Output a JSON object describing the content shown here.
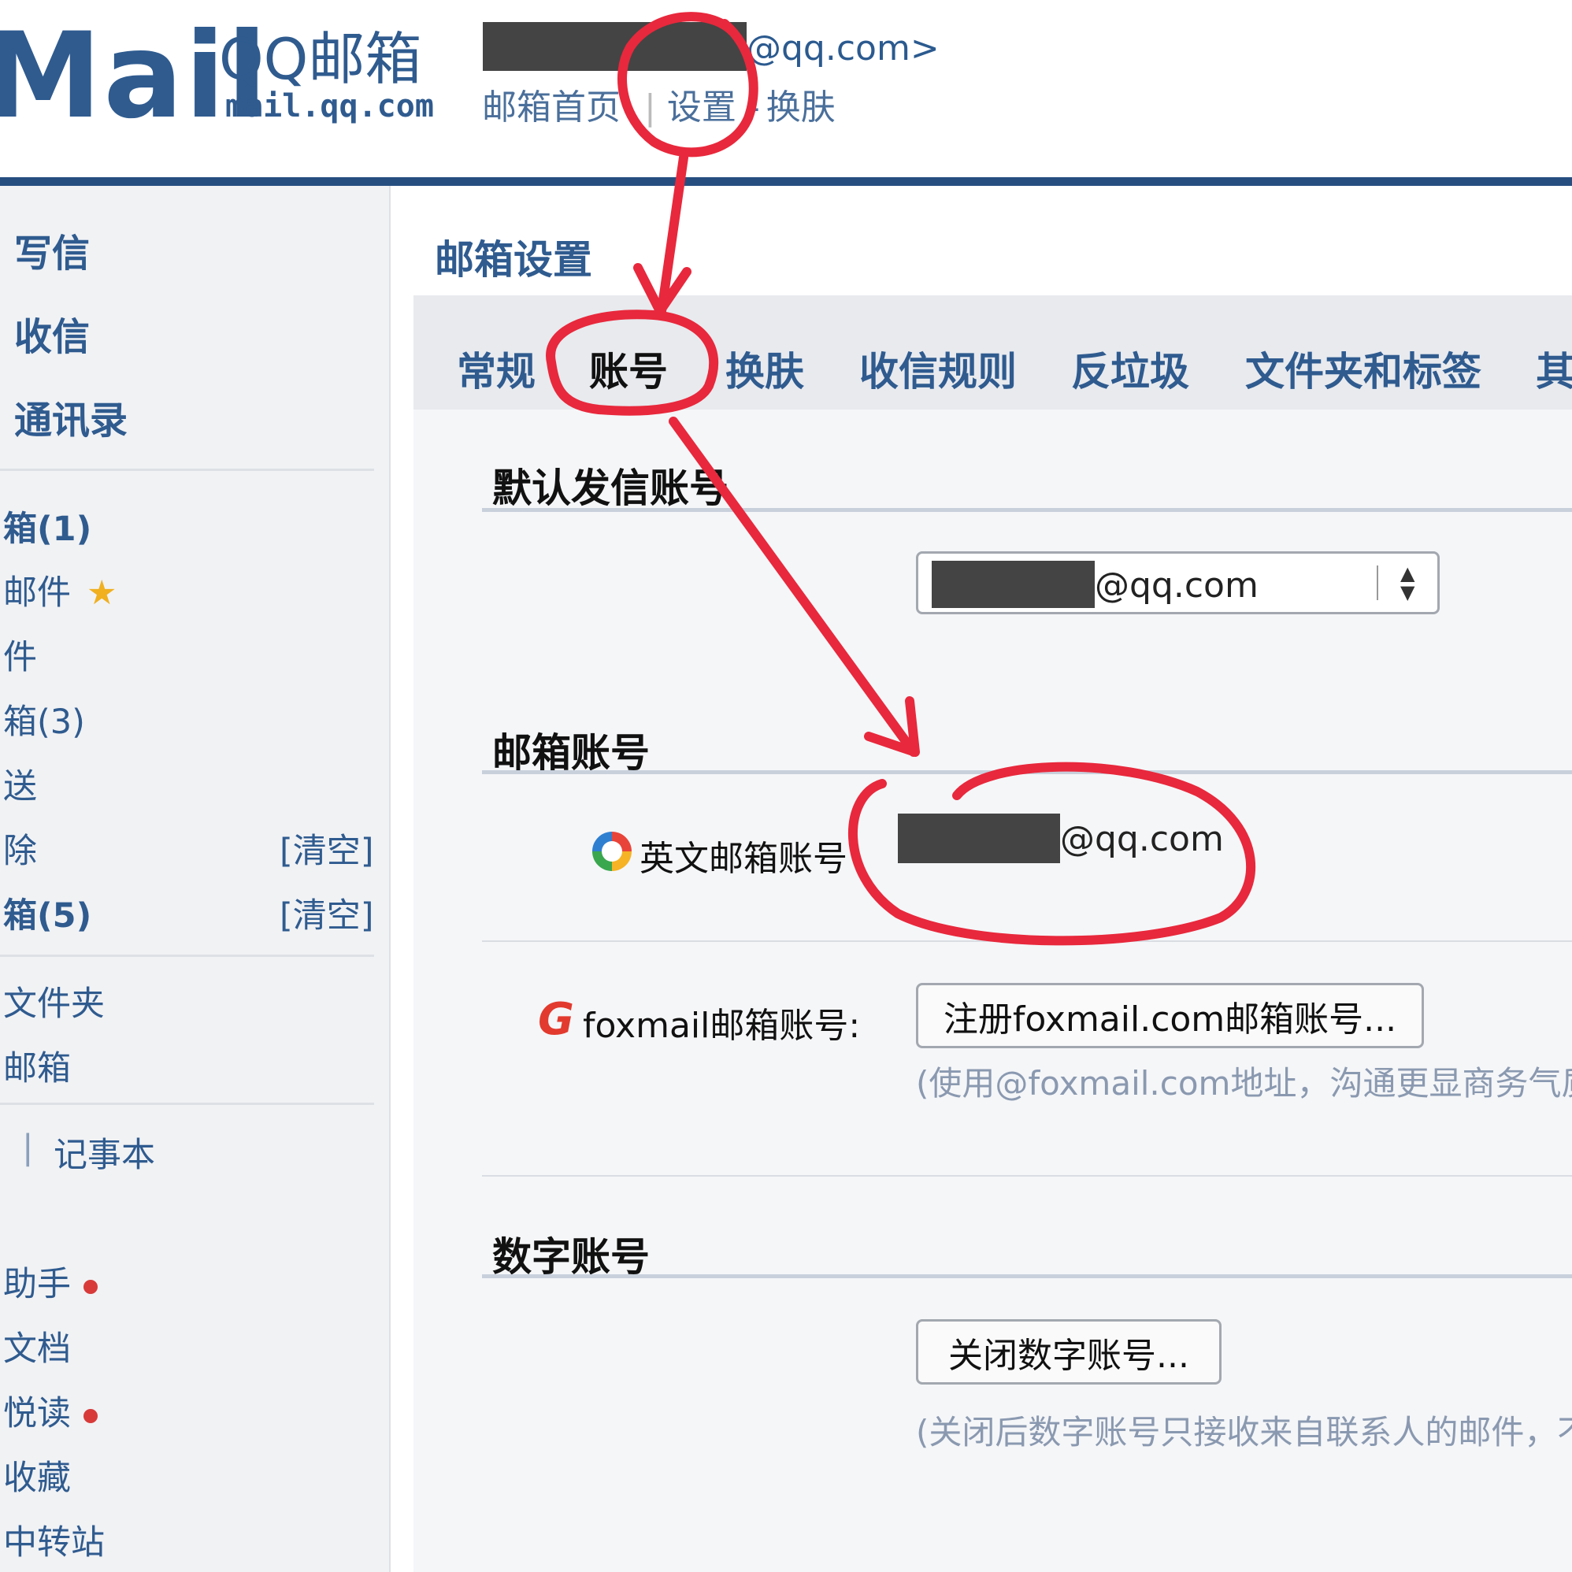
{
  "header": {
    "logo_word": "Mail",
    "logo_title": "QQ邮箱",
    "logo_domain": "mail.qq.com",
    "account_suffix": "@qq.com>",
    "nav": [
      "邮箱首页",
      "设置",
      "换肤"
    ],
    "nav_separator": "|",
    "nav_dash": "-"
  },
  "sidebar": {
    "main_links": [
      "写信",
      "收信",
      "通讯录"
    ],
    "folders": [
      {
        "label": "箱(1)"
      },
      {
        "label": "邮件",
        "star": "★"
      },
      {
        "label": "件"
      },
      {
        "label": "箱(3)"
      },
      {
        "label": "送"
      },
      {
        "label": "除",
        "action": "[清空]"
      },
      {
        "label": "箱(5)",
        "action": "[清空]"
      }
    ],
    "my_folders": [
      "文件夹",
      "邮箱"
    ],
    "tools_row": [
      "|",
      "记事本"
    ],
    "apps": [
      "助手",
      "文档",
      "悦读",
      "收藏",
      "中转站"
    ]
  },
  "main": {
    "title": "邮箱设置",
    "tabs": [
      "常规",
      "账号",
      "换肤",
      "收信规则",
      "反垃圾",
      "文件夹和标签",
      "其"
    ],
    "active_tab": "账号",
    "sections": {
      "default_sender": {
        "title": "默认发信账号",
        "select_value": "@qq.com"
      },
      "mail_account": {
        "title": "邮箱账号",
        "en_label": "英文邮箱账号",
        "en_value": "@qq.com",
        "fox_label": "foxmail邮箱账号:",
        "fox_button": "注册foxmail.com邮箱账号...",
        "fox_note": "(使用@foxmail.com地址，沟通更显商务气质"
      },
      "digit_account": {
        "title": "数字账号",
        "button": "关闭数字账号...",
        "note": "(关闭后数字账号只接收来自联系人的邮件，不"
      }
    }
  },
  "colors": {
    "brand": "#2f5b8f",
    "header_rule": "#264f80",
    "annotation": "#e8283c"
  }
}
